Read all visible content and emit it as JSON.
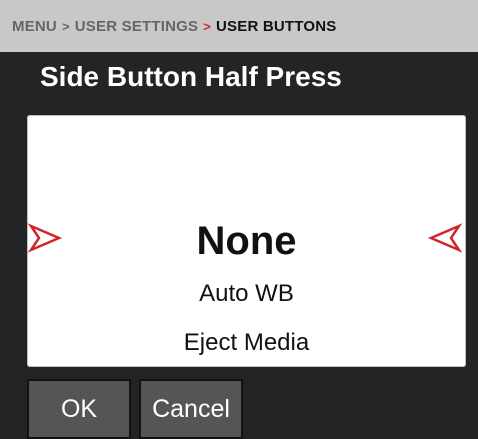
{
  "breadcrumb": {
    "items": [
      "MENU",
      "USER SETTINGS",
      "USER BUTTONS"
    ],
    "separator": ">"
  },
  "page_title": "Side Button Half Press",
  "selector": {
    "selected": "None",
    "options": [
      "Auto WB",
      "Eject Media"
    ],
    "prev_icon": "chevron-left-outline-icon",
    "next_icon": "chevron-right-outline-icon",
    "accent_color": "#d0262a"
  },
  "buttons": {
    "ok_label": "OK",
    "cancel_label": "Cancel"
  },
  "colors": {
    "background": "#242424",
    "breadcrumb_bar": "#c8c8c8",
    "button_fill": "#555555",
    "panel": "#ffffff"
  }
}
